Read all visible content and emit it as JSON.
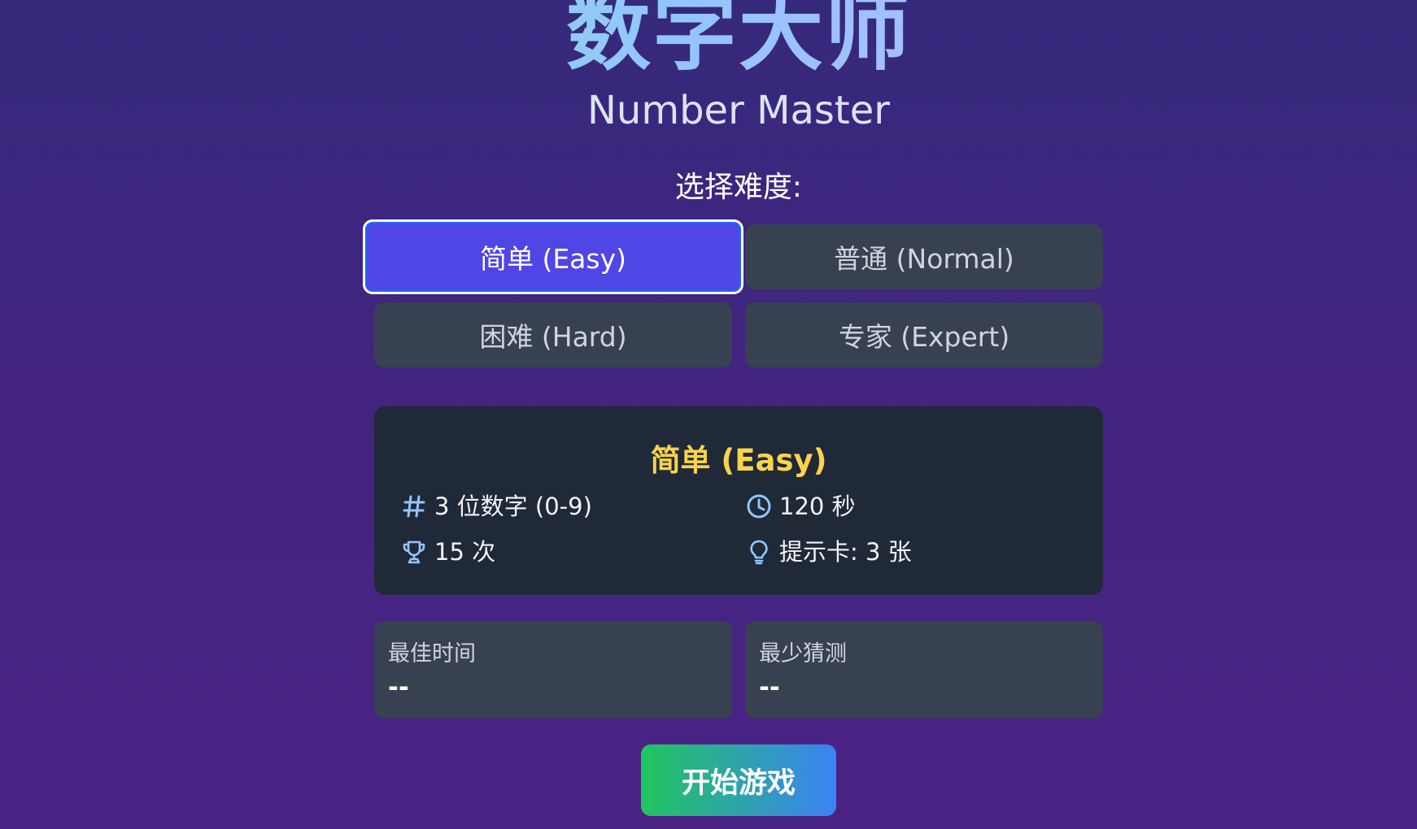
{
  "header": {
    "title_cn": "数字大师",
    "title_en": "Number Master"
  },
  "difficulty": {
    "label": "选择难度:",
    "options": [
      {
        "label": "简单 (Easy)",
        "selected": true
      },
      {
        "label": "普通 (Normal)",
        "selected": false
      },
      {
        "label": "困难 (Hard)",
        "selected": false
      },
      {
        "label": "专家 (Expert)",
        "selected": false
      }
    ]
  },
  "info": {
    "title": "简单 (Easy)",
    "digits": "3 位数字 (0-9)",
    "time": "120 秒",
    "attempts": "15 次",
    "hints": "提示卡: 3 张",
    "icons": [
      "hash-icon",
      "clock-icon",
      "trophy-icon",
      "lightbulb-icon"
    ]
  },
  "stats": {
    "best_time_label": "最佳时间",
    "best_time_value": "--",
    "fewest_guesses_label": "最少猜测",
    "fewest_guesses_value": "--"
  },
  "start_button": "开始游戏",
  "colors": {
    "accent": "#4f46e5",
    "highlight": "#fcd34d",
    "icon": "#93c5fd"
  }
}
